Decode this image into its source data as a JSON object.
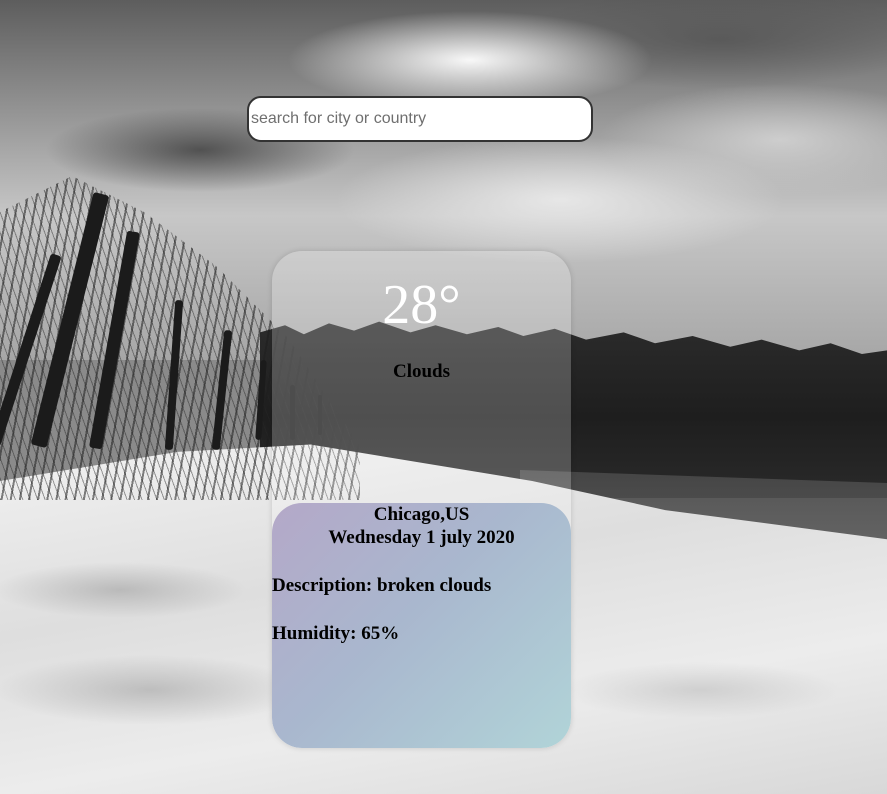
{
  "search": {
    "placeholder": "search for city or country",
    "value": ""
  },
  "weather": {
    "temperature": "28°",
    "condition": "Clouds",
    "location": "Chicago,US",
    "date": "Wednesday 1 july 2020",
    "description": "Description: broken clouds",
    "humidity": "Humidity: 65%"
  },
  "theme": {
    "card_gradient": [
      "#b4a8c8",
      "#a9b7ce",
      "#b1d4d8"
    ],
    "temperature_color": "#ffffff",
    "text_color": "#000000"
  }
}
